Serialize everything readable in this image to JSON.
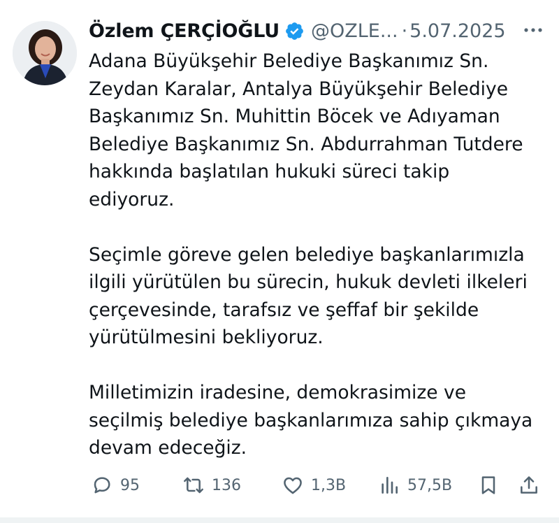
{
  "author": {
    "name": "Özlem ÇERÇİOĞLU",
    "handle": "@OZLE...",
    "separator": "·",
    "date": "5.07.2025",
    "avatar_icon": "profile-photo",
    "verified_icon": "verified-badge-icon"
  },
  "tweet": {
    "paragraphs": [
      {
        "lines": [
          "Adana Büyükşehir Belediye Başkanımız Sn.",
          "Zeydan Karalar, Antalya Büyükşehir Belediye",
          "Başkanımız Sn. Muhittin Böcek ve Adıyaman",
          "Belediye Başkanımız Sn. Abdurrahman Tutdere",
          "hakkında başlatılan hukuki süreci takip",
          "ediyoruz."
        ]
      },
      {
        "lines": [
          "Seçimle göreve gelen belediye başkanlarımızla",
          "ilgili yürütülen bu sürecin, hukuk devleti ilkeleri",
          "çerçevesinde, tarafsız ve şeffaf bir şekilde",
          "yürütülmesini bekliyoruz."
        ]
      },
      {
        "lines": [
          "Milletimizin iradesine, demokrasimize ve",
          "seçilmiş belediye başkanlarımıza sahip çıkmaya",
          "devam edeceğiz."
        ]
      }
    ]
  },
  "actions": {
    "replies": "95",
    "retweets": "136",
    "likes": "1,3B",
    "views": "57,5B"
  },
  "colors": {
    "text": "#0f1419",
    "secondary": "#536471",
    "verified": "#1d9bf0"
  }
}
